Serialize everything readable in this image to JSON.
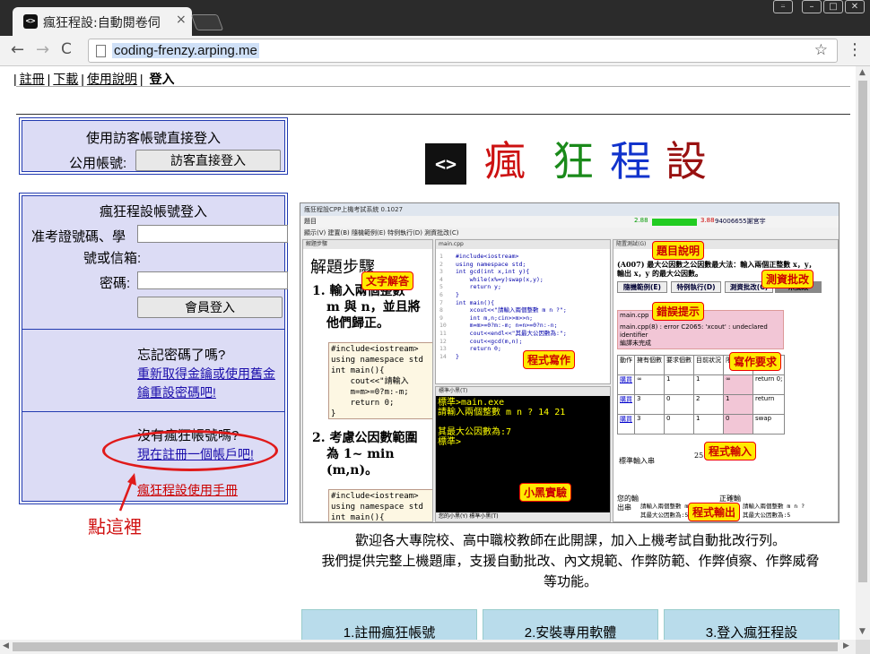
{
  "browser": {
    "tab_title": "瘋狂程設:自動閱卷伺",
    "tab_favicon": "<>",
    "tab_close": "×",
    "url": "coding-frenzy.arping.me",
    "back": "←",
    "forward": "→",
    "reload": "C",
    "star": "☆",
    "menu": "⋮",
    "window": {
      "user": "⍨",
      "minimize": "–",
      "maximize": "□",
      "close": "✕"
    }
  },
  "topnav": {
    "items": [
      "註冊",
      "下載",
      "使用說明"
    ],
    "current": "登入"
  },
  "guest_box": {
    "title": "使用訪客帳號直接登入",
    "label": "公用帳號:",
    "button": "訪客直接登入"
  },
  "login_box": {
    "title": "瘋狂程設帳號登入",
    "id_label_1": "准考證號碼、學",
    "id_label_2": "號或信箱:",
    "password_label": "密碼:",
    "submit": "會員登入",
    "forgot_q": "忘記密碼了嗎?",
    "forgot_link_1": "重新取得金鑰或使用舊金",
    "forgot_link_2": "鑰重設密碼吧!",
    "noacct_q": "沒有瘋狂帳號嗎?",
    "register_link": "現在註冊一個帳戶吧!",
    "manual_link": "瘋狂程設使用手冊"
  },
  "annotation": {
    "click_here": "點這裡",
    "color": "#d01010"
  },
  "logo": {
    "mark": "<>",
    "chars": [
      {
        "text": "瘋",
        "color": "#cc1111"
      },
      {
        "text": "狂",
        "color": "#1a8a1a"
      },
      {
        "text": "程",
        "color": "#1133cc"
      },
      {
        "text": "設",
        "color": "#991111"
      }
    ]
  },
  "screenshot": {
    "window_title": "瘋狂程設CPP上機考試系統 0.1027",
    "menu": "題目",
    "toolbar": "顯示(V)  建置(B)  隨機範例(E)  特例執行(D)  測資批改(C)",
    "score_label": "2.88",
    "score_label2": "3.88",
    "user": "94006655謝宮宇",
    "left_pane_title": "解題步驟",
    "left_heading": "解題步驟",
    "step1": [
      "1. 輸入兩個整數",
      "m 與 n，並且將",
      "他們歸正。"
    ],
    "step2": [
      "2. 考慮公因數範圍",
      "為 1~ min",
      "(m,n)。"
    ],
    "code1": "#include<iostream>\nusing namespace std\nint main(){\n    cout<<\"請輸入\n    m=m>=0?m:-m;\n    return 0;\n}",
    "code2": "#include<iostream>\nusing namespace std\nint main(){",
    "editor_tab": "main.cpp",
    "editor_lines": "1\n2\n3\n4\n5\n6\n7\n8\n9\n10\n11\n12\n13\n14",
    "editor_code": "#include<iostream>\nusing namespace std;\nint gcd(int x,int y){\n    while(x%=y)swap(x,y);\n    return y;\n}\nint main(){\n    xcout<<\"請輸入兩個整數 m n ?\";\n    int m,n;cin>>m>>n;\n    m=m>=0?m:-m; n=n>=0?n:-n;\n    cout<<endl<<\"其最大公因數為:\";\n    cout<<gcd(m,n);\n    return 0;\n}",
    "term_title": "標準小黑(T)",
    "term_text": "標準>main.exe\n請輸入兩個整數 m n ? 14 21\n\n其最大公因數為:7\n標準>",
    "term_tabs": "您的小黑(Y)  標準小黑(T)",
    "right_pane_title": "隨置測試(G)",
    "problem": "(A007) 最大公因數之公因數最大法：輸入兩個正整數 x，y，輸出 x，y 的最大公因數。",
    "btn_random": "隨機範例(E)",
    "btn_special": "特例執行(D)",
    "btn_test": "測資批改(C)",
    "btn_unmarked": "未批改",
    "err1": "main.cpp",
    "err2": "main.cpp(8) : error C2065: 'xcout' : undeclared identifier",
    "err3": "編譯未完成",
    "table_head": [
      "動作",
      "擁有個數",
      "要求個數",
      "目前狀況",
      "限制個數",
      "鍛備內容"
    ],
    "table_rows": [
      [
        "購買",
        "∞",
        "1",
        "1",
        "∞",
        "return 0;"
      ],
      [
        "購買",
        "3",
        "0",
        "2",
        "1",
        "return"
      ],
      [
        "購買",
        "3",
        "0",
        "1",
        "0",
        "swap"
      ]
    ],
    "std_input_label": "標準輸入串",
    "std_input": "25 15",
    "your_out_label": "您的輸出串",
    "correct_out_label": "正確輸出串",
    "out_text": "請輸入兩個整數 m n ?\n其最大公因數為:5",
    "tags": [
      "文字解答",
      "程式寫作",
      "小黑實驗",
      "題目說明",
      "測資批改",
      "錯誤提示",
      "寫作要求",
      "程式輸入",
      "程式輸出"
    ]
  },
  "welcome": {
    "line1": "歡迎各大專院校、高中職校教師在此開課，加入上機考試自動批改行列。",
    "line2": "我們提供完整上機題庫，支援自動批改、內文規範、作弊防範、作弊偵察、作弊威脅",
    "line3": "等功能。"
  },
  "steps": [
    "1.註冊瘋狂帳號",
    "2.安裝專用軟體",
    "3.登入瘋狂程設"
  ]
}
